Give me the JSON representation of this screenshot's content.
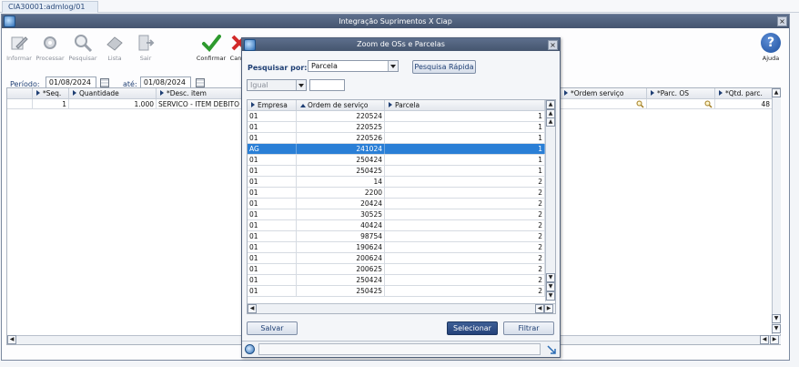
{
  "tab": {
    "label": "CIA30001:admlog/01"
  },
  "window": {
    "title": "Integração Suprimentos X Ciap",
    "close": "×"
  },
  "toolbar": {
    "informar": "Informar",
    "processar": "Processar",
    "pesquisar": "Pesquisar",
    "lista": "Lista",
    "sair": "Sair",
    "confirmar": "Confirmar",
    "cancelar": "Can",
    "ajuda": "Ajuda",
    "help_glyph": "?"
  },
  "period": {
    "label": "Período:",
    "start": "01/08/2024",
    "until_label": "até:",
    "end": "01/08/2024"
  },
  "grid": {
    "columns": [
      "*Seq.",
      "Quantidade",
      "*Desc. item",
      "*Ordem serviço",
      "*Parc. OS",
      "*Qtd. parc."
    ],
    "row": {
      "seq": "1",
      "quantidade": "1.000",
      "desc": "SERVICO - ITEM DEBITO DI",
      "qtd_parc": "48"
    }
  },
  "dialog": {
    "title": "Zoom de OSs e Parcelas",
    "close": "×",
    "search_label": "Pesquisar por:",
    "search_field": "Parcela",
    "quick_search": "Pesquisa Rápida",
    "operator": "Igual",
    "search_value": "",
    "columns": [
      "Empresa",
      "Ordem de serviço",
      "Parcela"
    ],
    "rows": [
      [
        "01",
        "220524",
        "1"
      ],
      [
        "01",
        "220525",
        "1"
      ],
      [
        "01",
        "220526",
        "1"
      ],
      [
        "AG",
        "241024",
        "1"
      ],
      [
        "01",
        "250424",
        "1"
      ],
      [
        "01",
        "250425",
        "1"
      ],
      [
        "01",
        "14",
        "2"
      ],
      [
        "01",
        "2200",
        "2"
      ],
      [
        "01",
        "20424",
        "2"
      ],
      [
        "01",
        "30525",
        "2"
      ],
      [
        "01",
        "40424",
        "2"
      ],
      [
        "01",
        "98754",
        "2"
      ],
      [
        "01",
        "190624",
        "2"
      ],
      [
        "01",
        "200624",
        "2"
      ],
      [
        "01",
        "200625",
        "2"
      ],
      [
        "01",
        "250424",
        "2"
      ],
      [
        "01",
        "250425",
        "2"
      ]
    ],
    "selected_index": 3,
    "salvar": "Salvar",
    "selecionar": "Selecionar",
    "filtrar": "Filtrar"
  },
  "colors": {
    "title_bar": "#4d5e7a",
    "selection": "#2a7fd6",
    "primary_button": "#24427a",
    "label_blue": "#1f3f74"
  }
}
